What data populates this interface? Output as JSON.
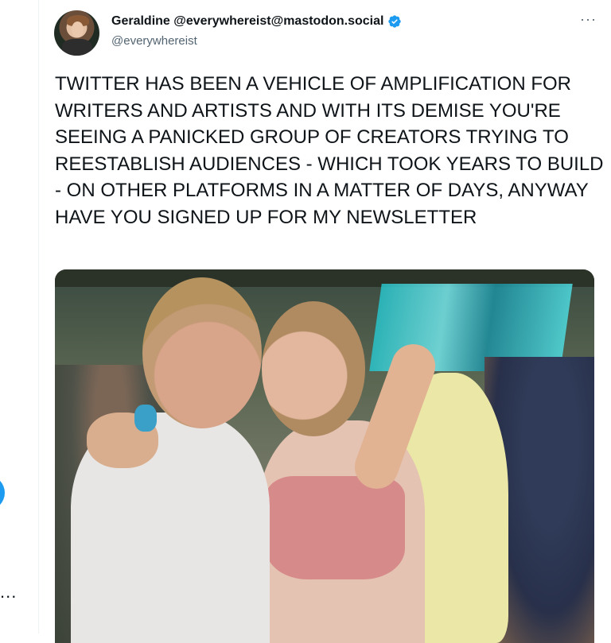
{
  "tweet": {
    "display_name": "Geraldine @everywhereist@mastodon.social",
    "handle": "@everywhereist",
    "more_label": "···",
    "text": "TWITTER HAS BEEN A VEHICLE OF AMPLIFICATION FOR WRITERS AND ARTISTS AND WITH ITS DEMISE YOU'RE SEEING A PANICKED GROUP OF CREATORS TRYING TO REESTABLISH AUDIENCES - WHICH TOOK YEARS TO BUILD - ON OTHER PLATFORMS IN A MATTER OF DAYS, ANYWAY HAVE YOU SIGNED UP FOR MY NEWSLETTER",
    "verified_icon": "verified-badge-icon",
    "media_icon": "photo"
  },
  "left_rail": {
    "more_label": "..."
  },
  "colors": {
    "accent": "#1d9bf0",
    "text_primary": "#0f1419",
    "text_secondary": "#536471"
  }
}
